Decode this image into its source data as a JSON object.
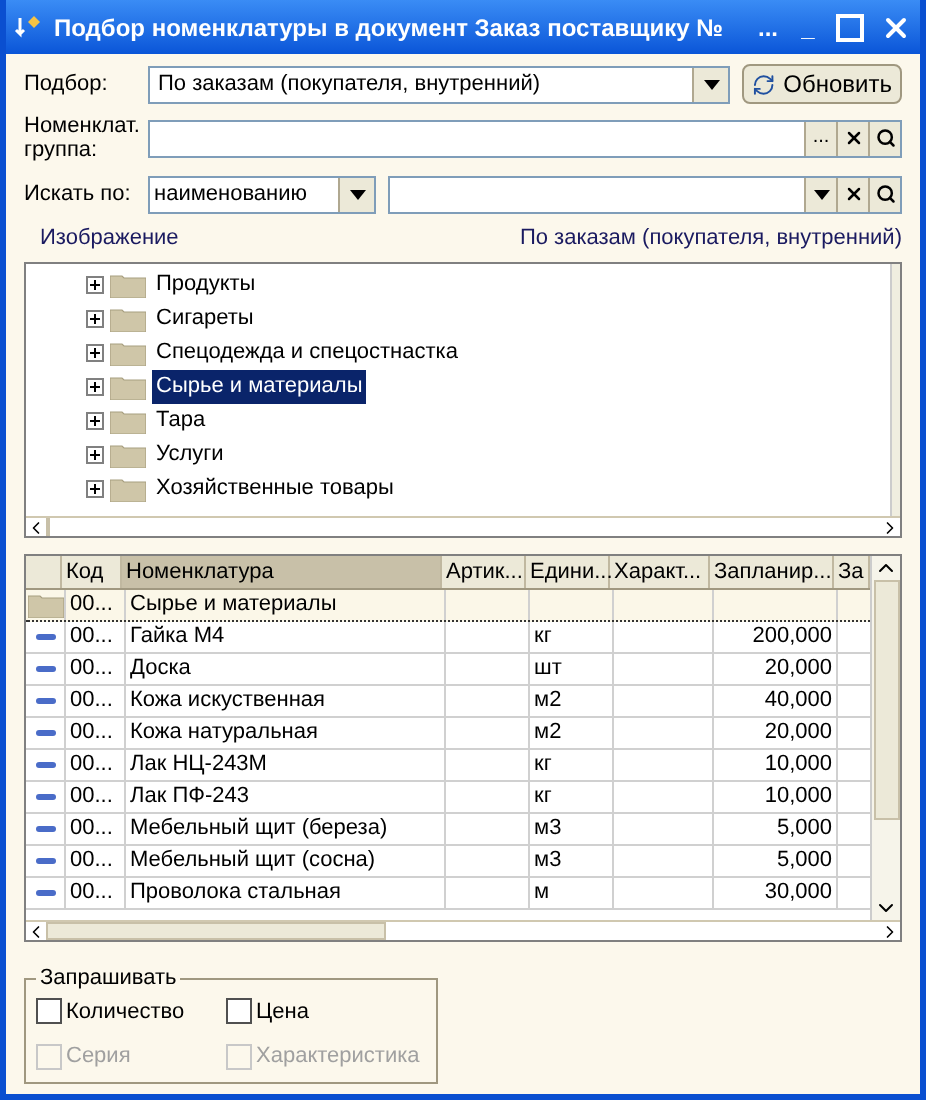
{
  "window": {
    "title": "Подбор номенклатуры в документ Заказ поставщику №",
    "controls": [
      "...",
      "_"
    ]
  },
  "selection": {
    "label": "Подбор:",
    "value": "По заказам (покупателя, внутренний)"
  },
  "refresh_button": {
    "label": "Обновить"
  },
  "group": {
    "label": "Номенклат. группа:",
    "button": "..."
  },
  "search": {
    "label": "Искать по:",
    "field": "наименованию"
  },
  "captions": {
    "left": "Изображение",
    "right": "По заказам (покупателя, внутренний)"
  },
  "tree": [
    {
      "label": "Продукты",
      "selected": false
    },
    {
      "label": "Сигареты",
      "selected": false
    },
    {
      "label": "Спецодежда и спецостнастка",
      "selected": false
    },
    {
      "label": "Сырье и материалы",
      "selected": true
    },
    {
      "label": "Тара",
      "selected": false
    },
    {
      "label": "Услуги",
      "selected": false
    },
    {
      "label": "Хозяйственные товары",
      "selected": false
    }
  ],
  "table": {
    "columns": [
      {
        "label": "Код",
        "selected": false
      },
      {
        "label": "Номенклатура",
        "selected": true
      },
      {
        "label": "Артик...",
        "selected": false
      },
      {
        "label": "Едини...",
        "selected": false
      },
      {
        "label": "Характ...",
        "selected": false
      },
      {
        "label": "Запланир...",
        "selected": false
      },
      {
        "label": "За",
        "selected": false
      }
    ],
    "rows": [
      {
        "kind": "folder",
        "code": "00...",
        "name": "Сырье и материалы",
        "selected": true
      },
      {
        "kind": "item",
        "code": "00...",
        "name": "Гайка М4",
        "unit": "кг",
        "planned": "200,000",
        "selected": false
      },
      {
        "kind": "item",
        "code": "00...",
        "name": "Доска",
        "unit": "шт",
        "planned": "20,000",
        "selected": false
      },
      {
        "kind": "item",
        "code": "00...",
        "name": "Кожа искуственная",
        "unit": "м2",
        "planned": "40,000",
        "selected": false
      },
      {
        "kind": "item",
        "code": "00...",
        "name": "Кожа натуральная",
        "unit": "м2",
        "planned": "20,000",
        "selected": false
      },
      {
        "kind": "item",
        "code": "00...",
        "name": "Лак НЦ-243М",
        "unit": "кг",
        "planned": "10,000",
        "selected": false
      },
      {
        "kind": "item",
        "code": "00...",
        "name": "Лак ПФ-243",
        "unit": "кг",
        "planned": "10,000",
        "selected": false
      },
      {
        "kind": "item",
        "code": "00...",
        "name": "Мебельный щит (береза)",
        "unit": "м3",
        "planned": "5,000",
        "selected": false
      },
      {
        "kind": "item",
        "code": "00...",
        "name": "Мебельный щит (сосна)",
        "unit": "м3",
        "planned": "5,000",
        "selected": false
      },
      {
        "kind": "item",
        "code": "00...",
        "name": "Проволока стальная",
        "unit": "м",
        "planned": "30,000",
        "selected": false
      }
    ]
  },
  "ask": {
    "title": "Запрашивать",
    "options": [
      {
        "label": "Количество",
        "checked": false,
        "disabled": false
      },
      {
        "label": "Цена",
        "checked": false,
        "disabled": false
      },
      {
        "label": "Серия",
        "checked": false,
        "disabled": true
      },
      {
        "label": "Характеристика",
        "checked": false,
        "disabled": true
      }
    ]
  }
}
